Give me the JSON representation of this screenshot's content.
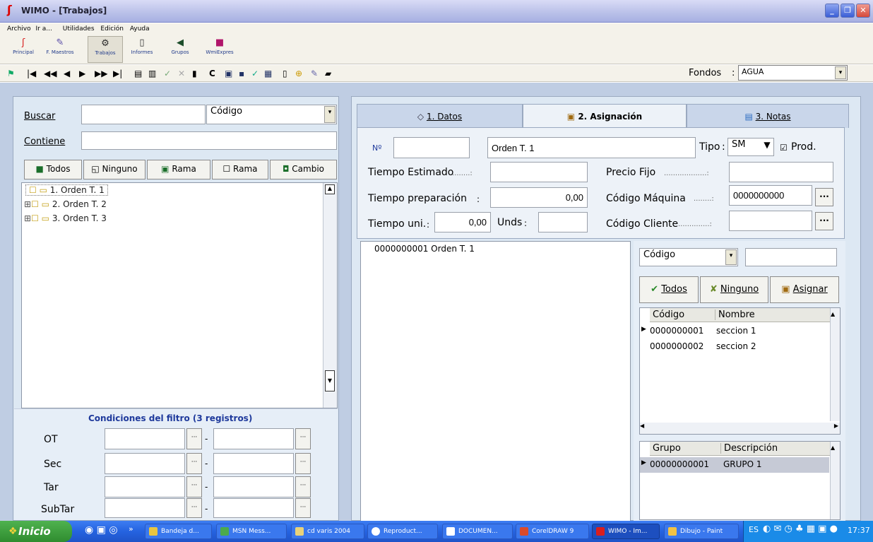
{
  "window": {
    "title": "WIMO - [Trabajos]",
    "min": "_",
    "max": "❐",
    "close": "✕"
  },
  "menu": [
    "Archivo",
    "Ir a...",
    "Utilidades",
    "Edición",
    "Ayuda"
  ],
  "toolbar1": [
    {
      "label": "Principal",
      "icon": "principal-icon",
      "color": "#d81e1e"
    },
    {
      "label": "F. Maestros",
      "icon": "maestros-icon",
      "color": "#5a4ca8"
    },
    {
      "label": "Trabajos",
      "icon": "trabajos-icon",
      "color": "#2b2b2b"
    },
    {
      "label": "Informes",
      "icon": "informes-icon",
      "color": "#333333"
    },
    {
      "label": "Grupos",
      "icon": "grupos-icon",
      "color": "#1c4d2a"
    },
    {
      "label": "WmiExpres",
      "icon": "wmiexpres-icon",
      "color": "#b0156a"
    }
  ],
  "toolbar2": {
    "nav": [
      "|◀",
      "◀◀",
      "◀",
      "▶",
      "▶▶",
      "▶|"
    ],
    "fondos_label": "Fondos",
    "fondos_value": "AGUA"
  },
  "left": {
    "buscar_label": "Buscar",
    "buscar_value": "",
    "buscar_select": "Código",
    "contiene_label": "Contiene",
    "contiene_value": "",
    "buttons": [
      "Todos",
      "Ninguno",
      "Rama",
      "Rama",
      "Cambio"
    ],
    "tree": [
      "1. Orden T. 1",
      "2. Orden T. 2",
      "3. Orden T. 3"
    ],
    "cond_title": "Condiciones del filtro (3 registros)",
    "cond_rows": [
      "OT",
      "Sec",
      "Tar",
      "SubTar"
    ]
  },
  "tabs": [
    "1. Datos",
    "2. Asignación",
    "3. Notas"
  ],
  "form": {
    "no_label": "Nº",
    "no_value": "",
    "name_value": "Orden T. 1",
    "tipo_label": "Tipo",
    "tipo_value": "SM",
    "prod_label": "Prod.",
    "tiempo_estimado_label": "Tiempo Estimado",
    "tiempo_estimado_value": "",
    "precio_fijo_label": "Precio Fijo",
    "precio_fijo_value": "",
    "tiempo_prep_label": "Tiempo preparación",
    "tiempo_prep_value": "0,00",
    "codigo_maquina_label": "Código Máquina",
    "codigo_maquina_value": "0000000000",
    "tiempo_uni_label": "Tiempo uni.",
    "tiempo_uni_value": "0,00",
    "unds_label": "Unds",
    "unds_value": "",
    "codigo_cliente_label": "Código Cliente",
    "codigo_cliente_value": ""
  },
  "assigned": [
    "0000000001 Orden T. 1"
  ],
  "right": {
    "select_value": "Código",
    "search_value": "",
    "btn_todos": "Todos",
    "btn_ninguno": "Ninguno",
    "btn_asignar": "Asignar",
    "grid1_headers": [
      "Código",
      "Nombre"
    ],
    "grid1_rows": [
      [
        "0000000001",
        "seccion 1"
      ],
      [
        "0000000002",
        "seccion 2"
      ]
    ],
    "grid2_headers": [
      "Grupo",
      "Descripción"
    ],
    "grid2_rows": [
      [
        "00000000001",
        "GRUPO 1"
      ]
    ]
  },
  "taskbar": {
    "start": "Inicio",
    "items": [
      "Bandeja d...",
      "MSN Mess...",
      "cd varis 2004",
      "Reproduct...",
      "DOCUMEN...",
      "CorelDRAW 9",
      "WIMO - Im...",
      "Dibujo - Paint"
    ],
    "lang": "ES",
    "time": "17:37"
  }
}
